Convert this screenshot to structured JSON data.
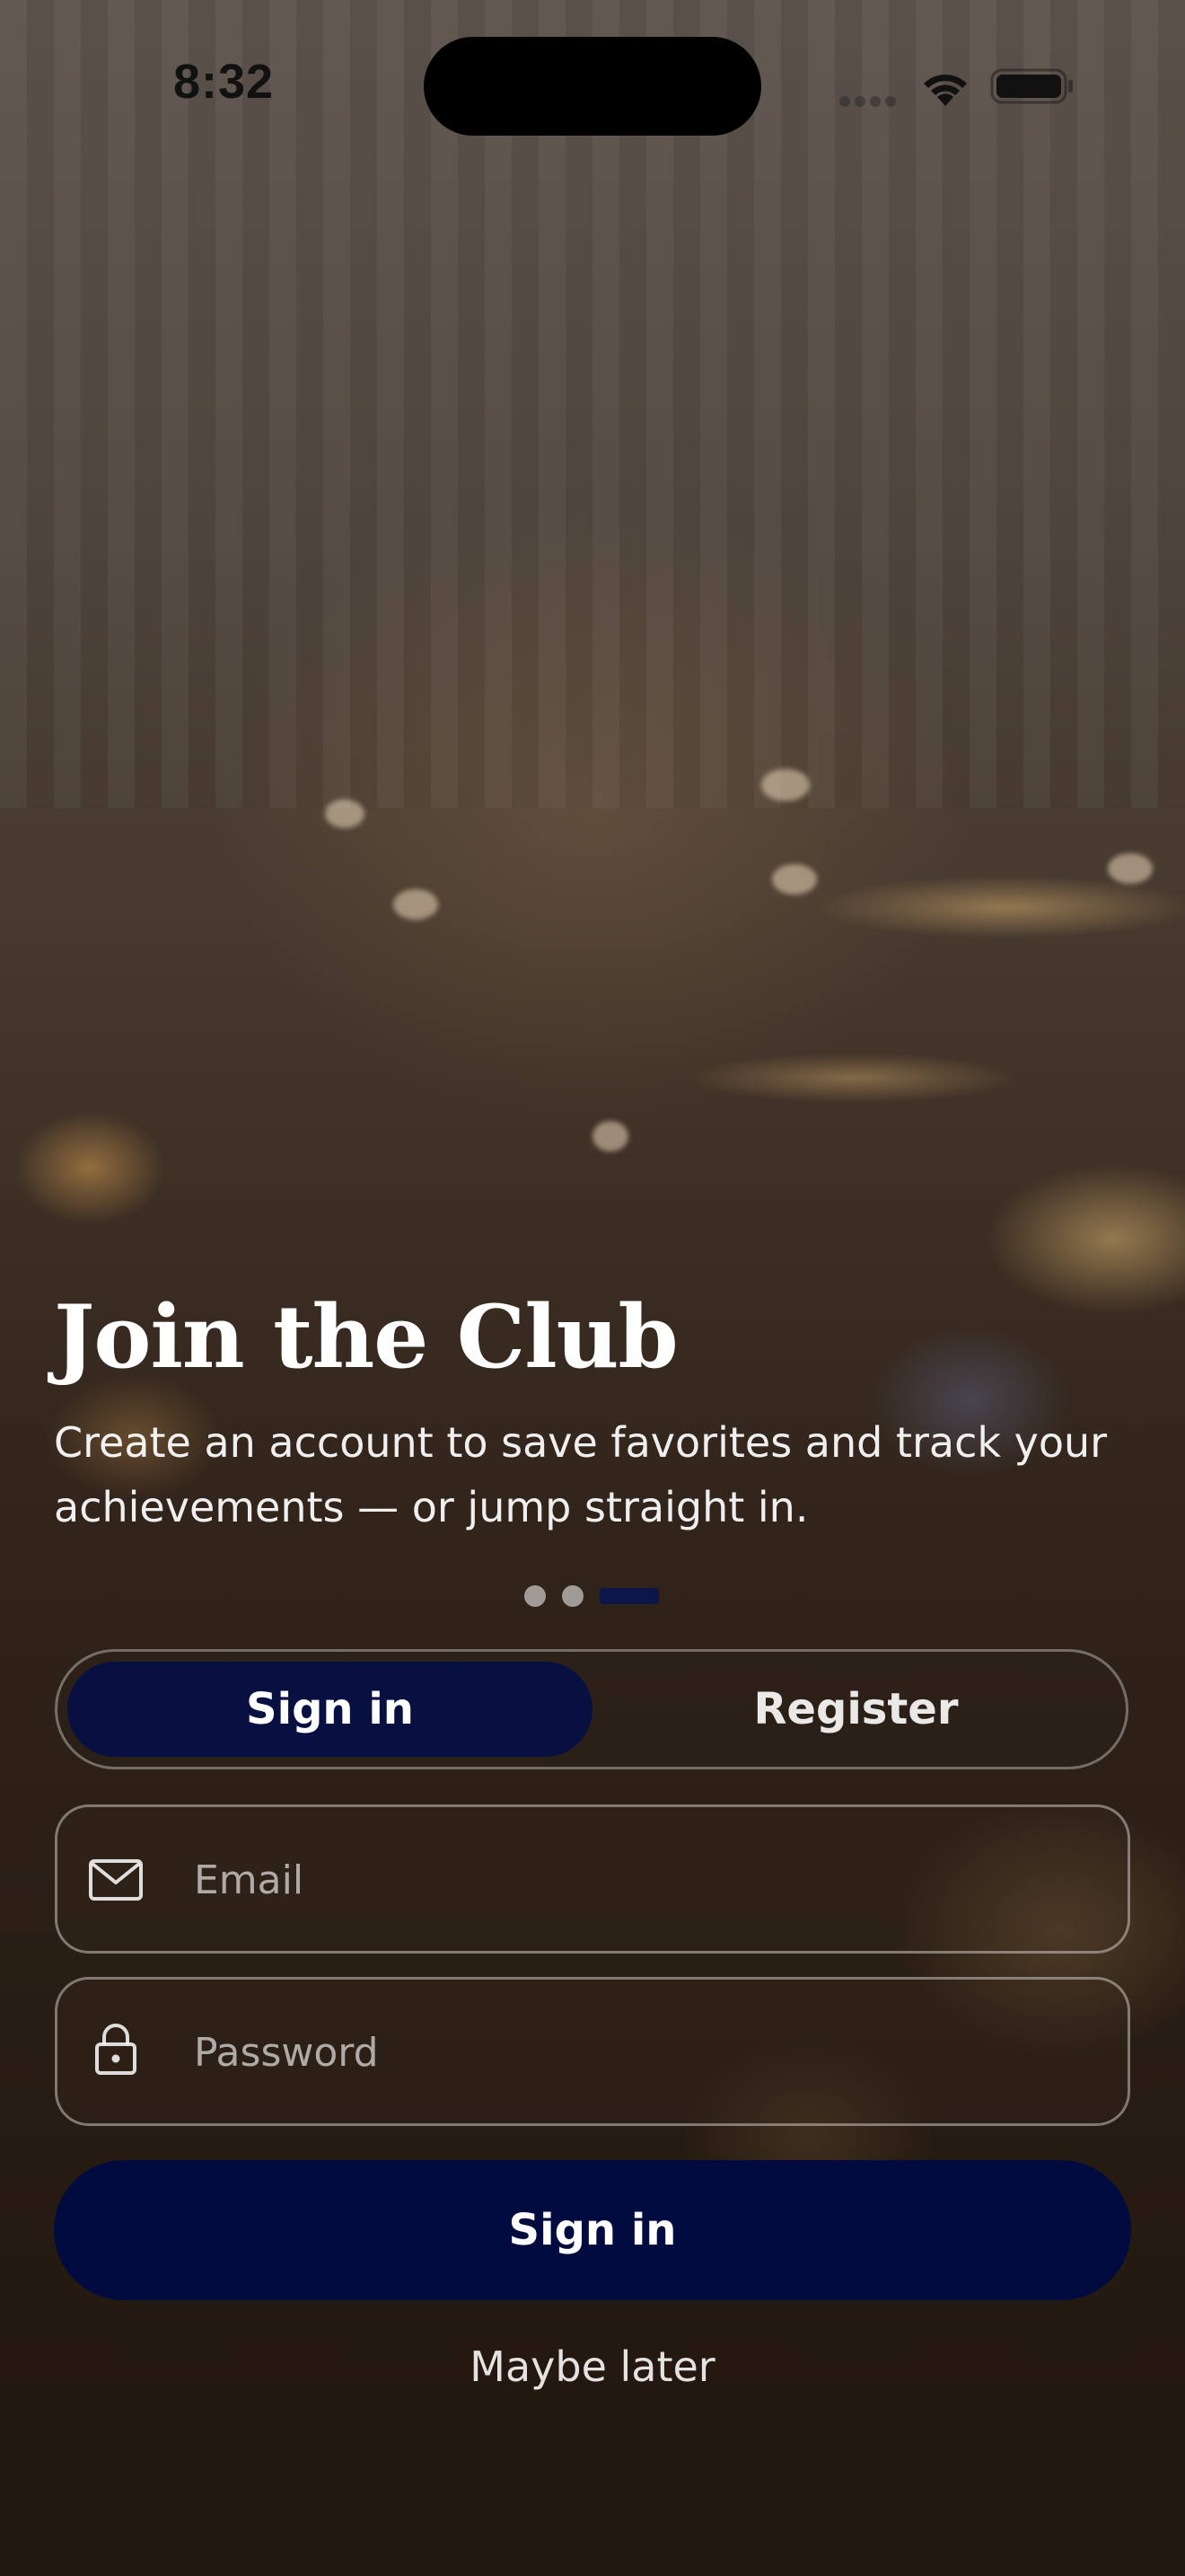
{
  "status_bar": {
    "time": "8:32"
  },
  "hero": {
    "title": "Join the Club",
    "subtitle": "Create an account to save favorites and track your achievements — or jump straight in."
  },
  "pager": {
    "pages": 3,
    "active_index": 2
  },
  "auth_tabs": {
    "sign_in_label": "Sign in",
    "register_label": "Register",
    "selected": "Sign in"
  },
  "form": {
    "email_placeholder": "Email",
    "email_value": "",
    "password_placeholder": "Password",
    "password_value": "",
    "submit_label": "Sign in",
    "skip_label": "Maybe later"
  },
  "icons": {
    "email": "envelope-icon",
    "password": "lock-icon",
    "signal": "cellular-signal-icon",
    "wifi": "wifi-icon",
    "battery": "battery-icon"
  },
  "colors": {
    "accent": "#081042",
    "primary_button": "#020b3f",
    "text_primary": "#ffffff",
    "status_text": "#111111"
  }
}
